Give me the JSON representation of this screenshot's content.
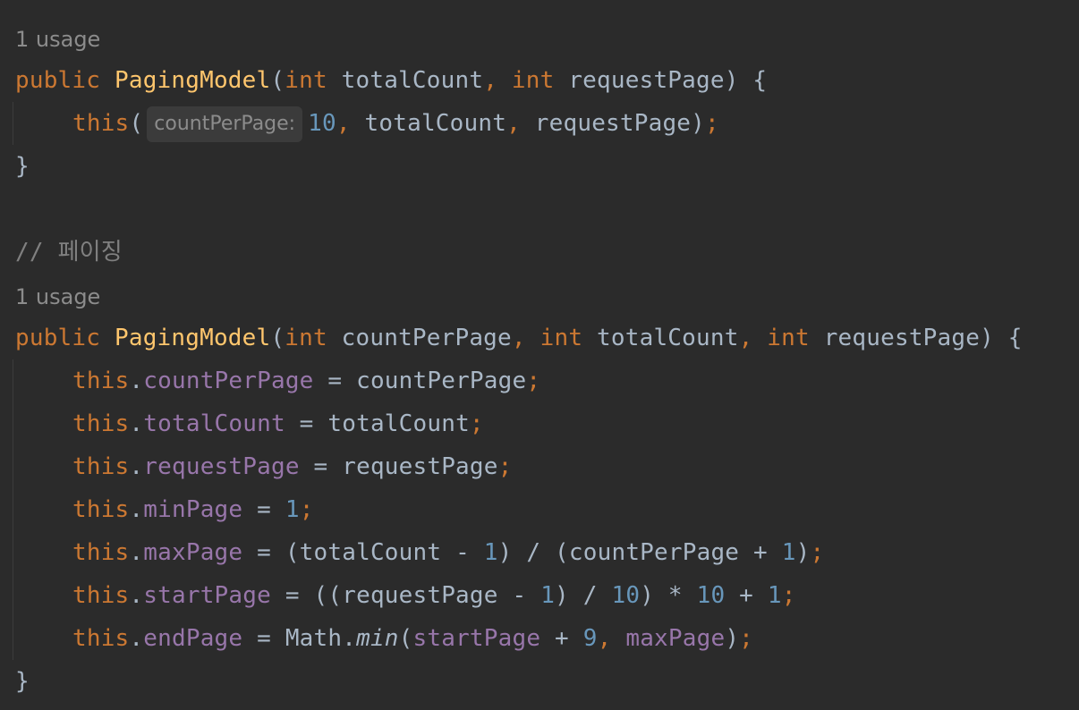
{
  "code": {
    "usage1": "1 usage",
    "ctor1": {
      "kw_public": "public",
      "name": "PagingModel",
      "open": "(",
      "kw_int1": "int",
      "p1": " totalCount",
      "comma1": ",",
      "kw_int2": "int",
      "p2": " requestPage",
      "close": ") {"
    },
    "call": {
      "kw_this": "this",
      "open": "(",
      "hint": "countPerPage:",
      "num10": "10",
      "comma1": ",",
      "arg2": " totalCount",
      "comma2": ",",
      "arg3": " requestPage",
      "close": ")",
      "semi": ";"
    },
    "brace_close1": "}",
    "comment": {
      "slashes": "// ",
      "text": "페이징"
    },
    "usage2": "1 usage",
    "ctor2": {
      "kw_public": "public",
      "name": "PagingModel",
      "open": "(",
      "kw_int1": "int",
      "p1": " countPerPage",
      "comma1": ",",
      "kw_int2": "int",
      "p2": " totalCount",
      "comma2": ",",
      "kw_int3": "int",
      "p3": " requestPage",
      "close": ") {"
    },
    "body": {
      "l1": {
        "this": "this",
        "dot": ".",
        "field": "countPerPage",
        "rest": " = countPerPage",
        "semi": ";"
      },
      "l2": {
        "this": "this",
        "dot": ".",
        "field": "totalCount",
        "rest": " = totalCount",
        "semi": ";"
      },
      "l3": {
        "this": "this",
        "dot": ".",
        "field": "requestPage",
        "rest": " = requestPage",
        "semi": ";"
      },
      "l4": {
        "this": "this",
        "dot": ".",
        "field": "minPage",
        "eq": " = ",
        "n1": "1",
        "semi": ";"
      },
      "l5": {
        "this": "this",
        "dot": ".",
        "field": "maxPage",
        "a": " = (totalCount - ",
        "n1": "1",
        "b": ") / (countPerPage + ",
        "n2": "1",
        "c": ")",
        "semi": ";"
      },
      "l6": {
        "this": "this",
        "dot": ".",
        "field": "startPage",
        "a": " = ((requestPage - ",
        "n1": "1",
        "b": ") / ",
        "n2": "10",
        "c": ") * ",
        "n3": "10",
        "d": " + ",
        "n4": "1",
        "semi": ";"
      },
      "l7": {
        "this": "this",
        "dot": ".",
        "field": "endPage",
        "a": " = Math.",
        "method": "min",
        "b": "(",
        "f2": "startPage",
        "c": " + ",
        "n1": "9",
        "comma": ",",
        "f3": " maxPage",
        "d": ")",
        "semi": ";"
      }
    },
    "brace_close2": "}"
  }
}
